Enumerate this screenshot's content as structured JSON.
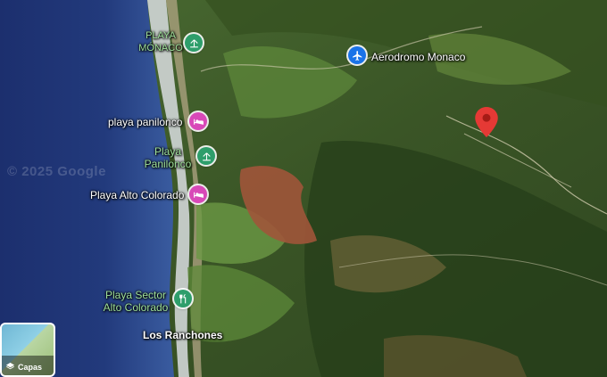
{
  "map": {
    "watermark": "© 2025 Google",
    "layers_label": "Capas",
    "places": [
      {
        "label": "PLAYA MÓNACO",
        "kind": "beach",
        "icon": "beach-icon",
        "color": "#2e9e6b"
      },
      {
        "label": "Aerodromo Monaco",
        "kind": "airport",
        "icon": "airplane-icon",
        "color": "#1a73e8"
      },
      {
        "label": "playa panilonco",
        "kind": "lodging",
        "icon": "bed-icon",
        "color": "#d849b8"
      },
      {
        "label": "Playa Panilonco",
        "kind": "beach",
        "icon": "beach-icon",
        "color": "#2e9e6b"
      },
      {
        "label": "Playa Alto Colorado",
        "kind": "lodging",
        "icon": "bed-icon",
        "color": "#d849b8"
      },
      {
        "label": "Playa Sector Alto Colorado",
        "kind": "restaurant",
        "icon": "restaurant-icon",
        "color": "#2e9e6b"
      },
      {
        "label": "Los Ranchones",
        "kind": "place"
      }
    ],
    "selected_marker": {
      "icon": "red-location-pin-icon",
      "color": "#e53935"
    }
  }
}
